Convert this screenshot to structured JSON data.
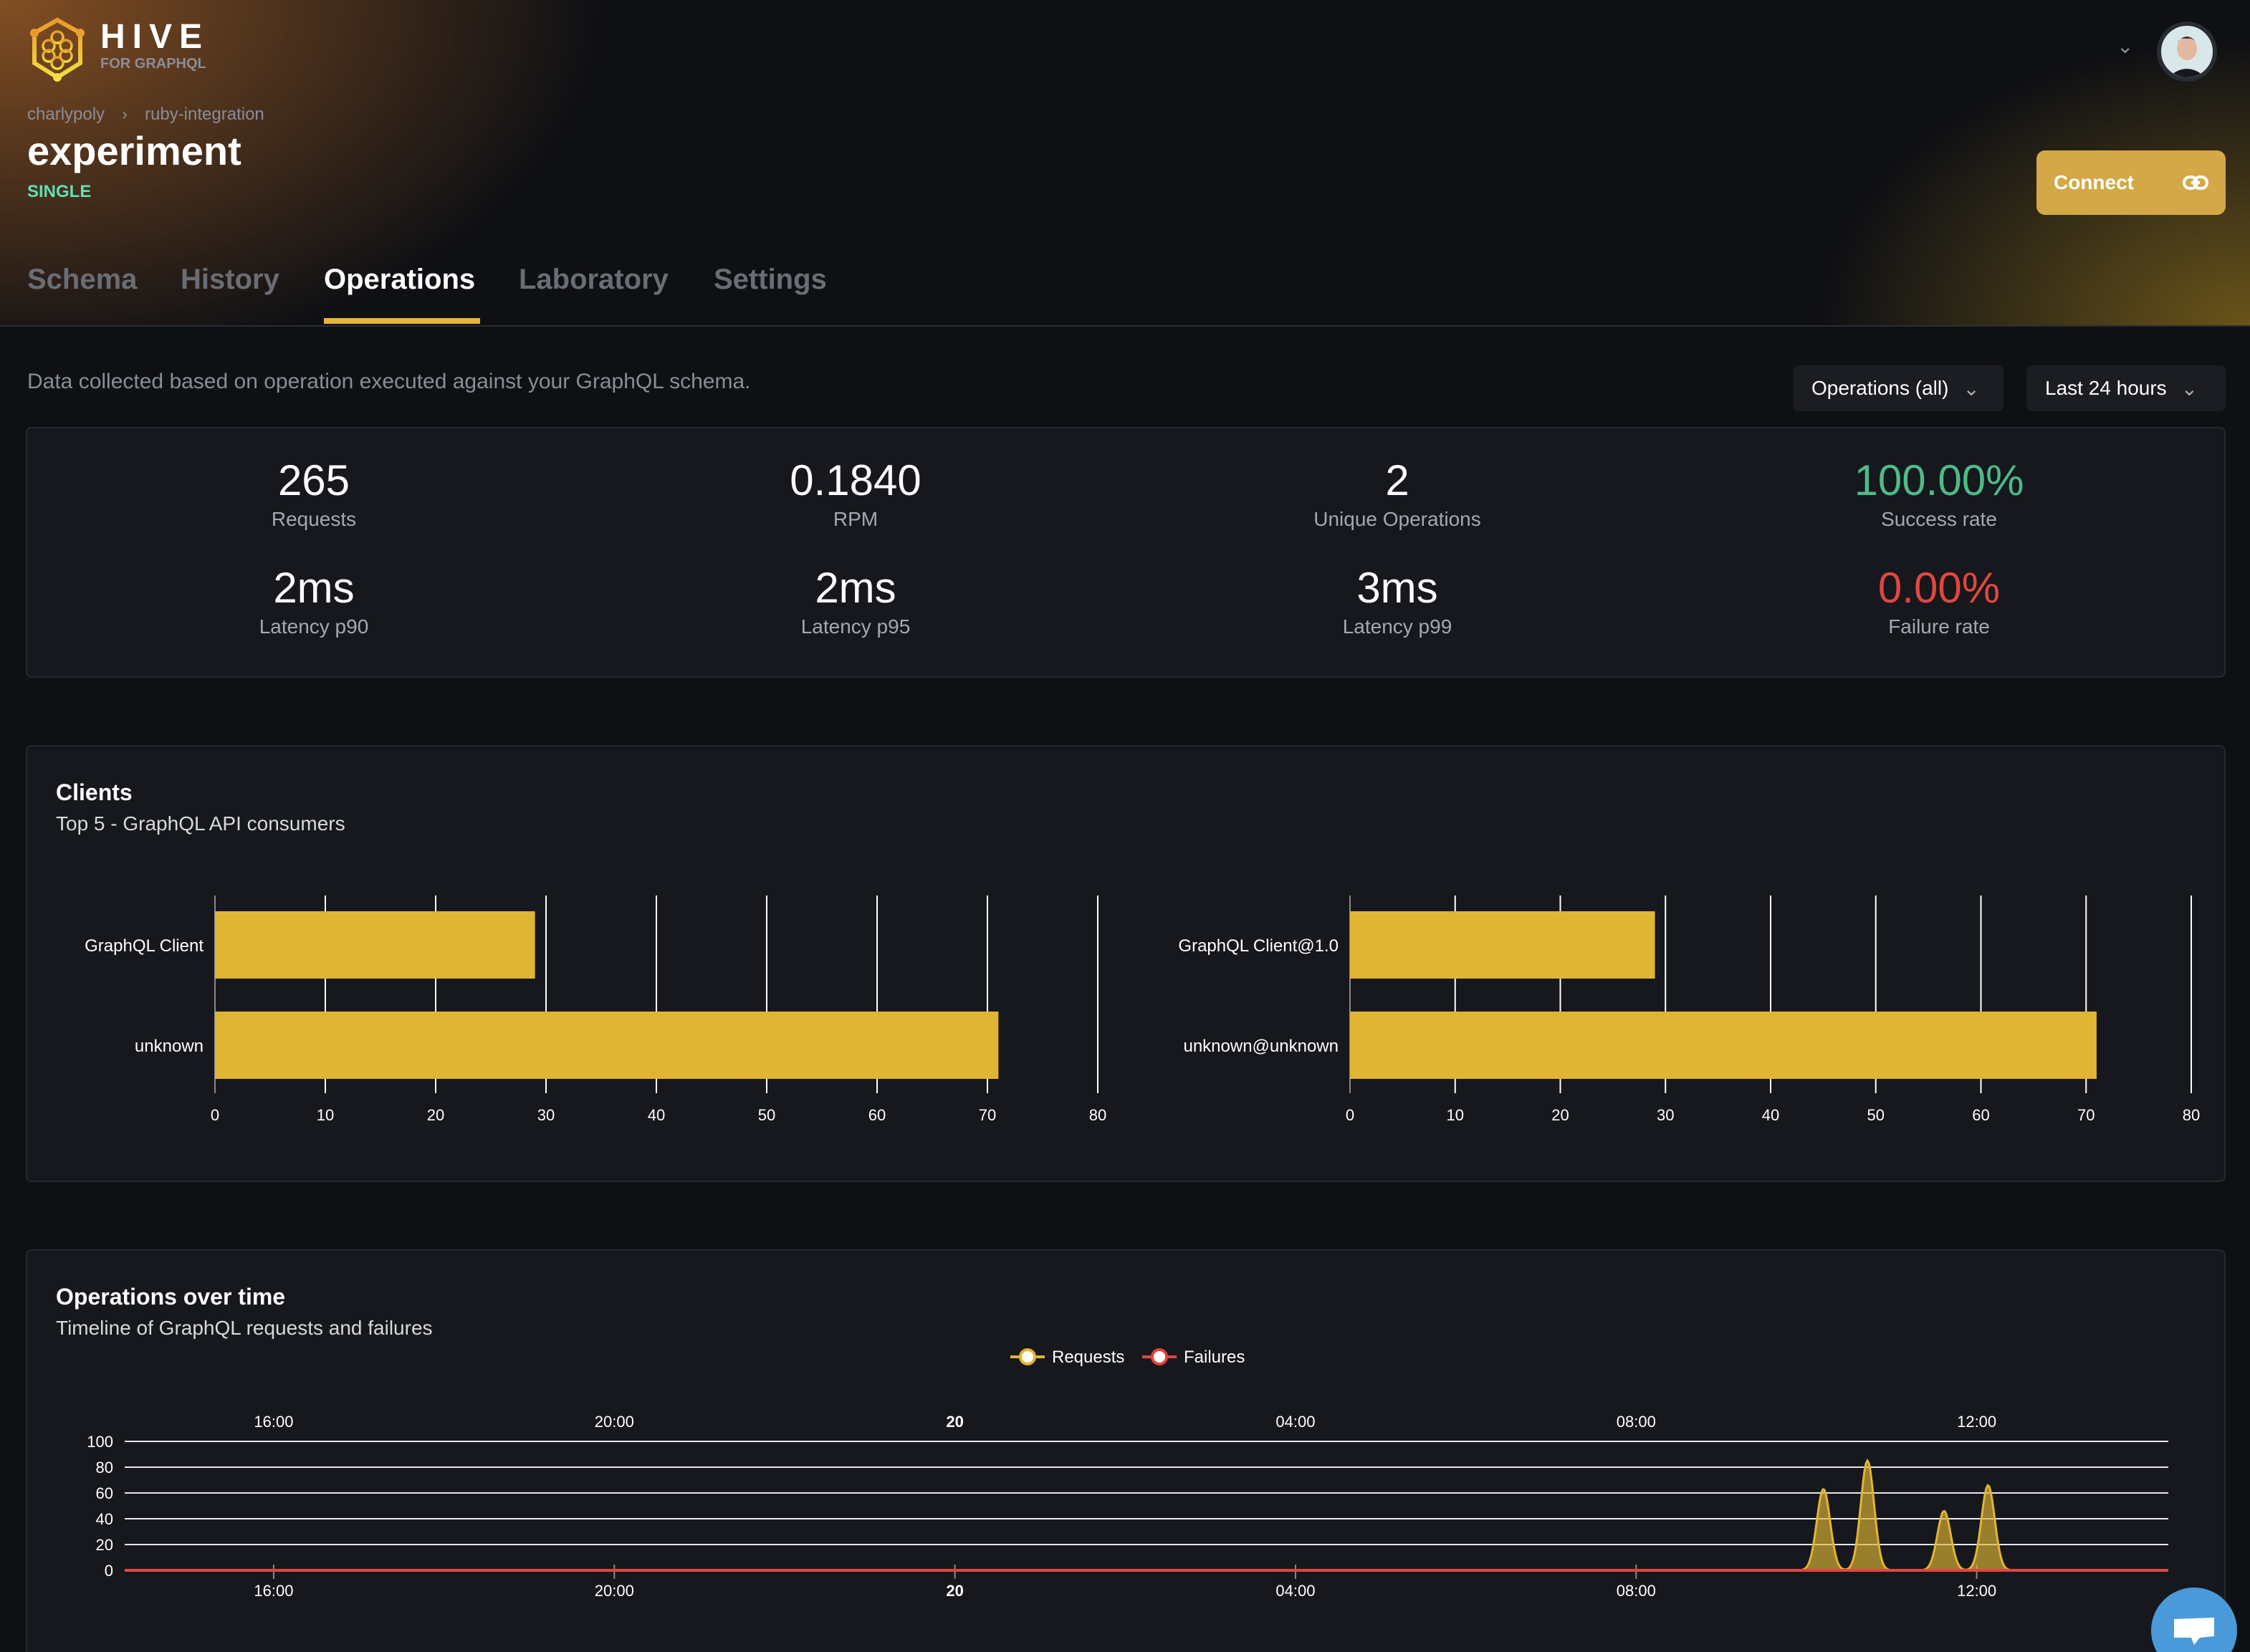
{
  "brand": {
    "name": "HIVE",
    "tagline": "FOR GRAPHQL"
  },
  "breadcrumb": [
    "charlypoly",
    "ruby-integration"
  ],
  "project": {
    "title": "experiment",
    "type": "SINGLE"
  },
  "header": {
    "connect_label": "Connect",
    "avatar": "user-avatar"
  },
  "tabs": [
    {
      "label": "Schema"
    },
    {
      "label": "History"
    },
    {
      "label": "Operations",
      "active": true
    },
    {
      "label": "Laboratory"
    },
    {
      "label": "Settings"
    }
  ],
  "description": "Data collected based on operation executed against your GraphQL schema.",
  "filters": {
    "operations": "Operations (all)",
    "period": "Last 24 hours"
  },
  "stats": [
    {
      "value": "265",
      "label": "Requests"
    },
    {
      "value": "0.1840",
      "label": "RPM"
    },
    {
      "value": "2",
      "label": "Unique Operations"
    },
    {
      "value": "100.00%",
      "label": "Success rate",
      "color": "#4dbb8a"
    },
    {
      "value": "2ms",
      "label": "Latency p90"
    },
    {
      "value": "2ms",
      "label": "Latency p95"
    },
    {
      "value": "3ms",
      "label": "Latency p99"
    },
    {
      "value": "0.00%",
      "label": "Failure rate",
      "color": "#e0473f"
    }
  ],
  "clients": {
    "title": "Clients",
    "subtitle": "Top 5 - GraphQL API consumers"
  },
  "timeline": {
    "title": "Operations over time",
    "subtitle": "Timeline of GraphQL requests and failures"
  },
  "chart_data": [
    {
      "type": "bar",
      "orientation": "horizontal",
      "categories": [
        "GraphQL Client",
        "unknown"
      ],
      "values": [
        29,
        71
      ],
      "xlim": [
        0,
        80
      ],
      "xticks": [
        "0",
        "10",
        "20",
        "30",
        "40",
        "50",
        "60",
        "70",
        "80"
      ],
      "color": "#e0b534",
      "grid": true
    },
    {
      "type": "bar",
      "orientation": "horizontal",
      "categories": [
        "GraphQL Client@1.0",
        "unknown@unknown"
      ],
      "values": [
        29,
        71
      ],
      "xlim": [
        0,
        80
      ],
      "xticks": [
        "0",
        "10",
        "20",
        "30",
        "40",
        "50",
        "60",
        "70",
        "80"
      ],
      "color": "#e0b534",
      "grid": true
    },
    {
      "type": "area",
      "legend": {
        "position": "top",
        "entries": [
          "Requests",
          "Failures"
        ]
      },
      "xticks": [
        "16:00",
        "20:00",
        "20",
        "04:00",
        "08:00",
        "12:00"
      ],
      "yticks": [
        "0",
        "20",
        "40",
        "60",
        "80",
        "100"
      ],
      "ylim": [
        0,
        100
      ],
      "xrange": [
        "14:15",
        "14:15 (+1d)"
      ],
      "series": [
        {
          "name": "Requests",
          "color": "#e0b534",
          "peaks": [
            {
              "time": "10:12",
              "value": 63
            },
            {
              "time": "10:43",
              "value": 85
            },
            {
              "time": "11:37",
              "value": 46
            },
            {
              "time": "12:08",
              "value": 66
            }
          ]
        },
        {
          "name": "Failures",
          "color": "#e0473f",
          "value": 0
        }
      ]
    }
  ]
}
